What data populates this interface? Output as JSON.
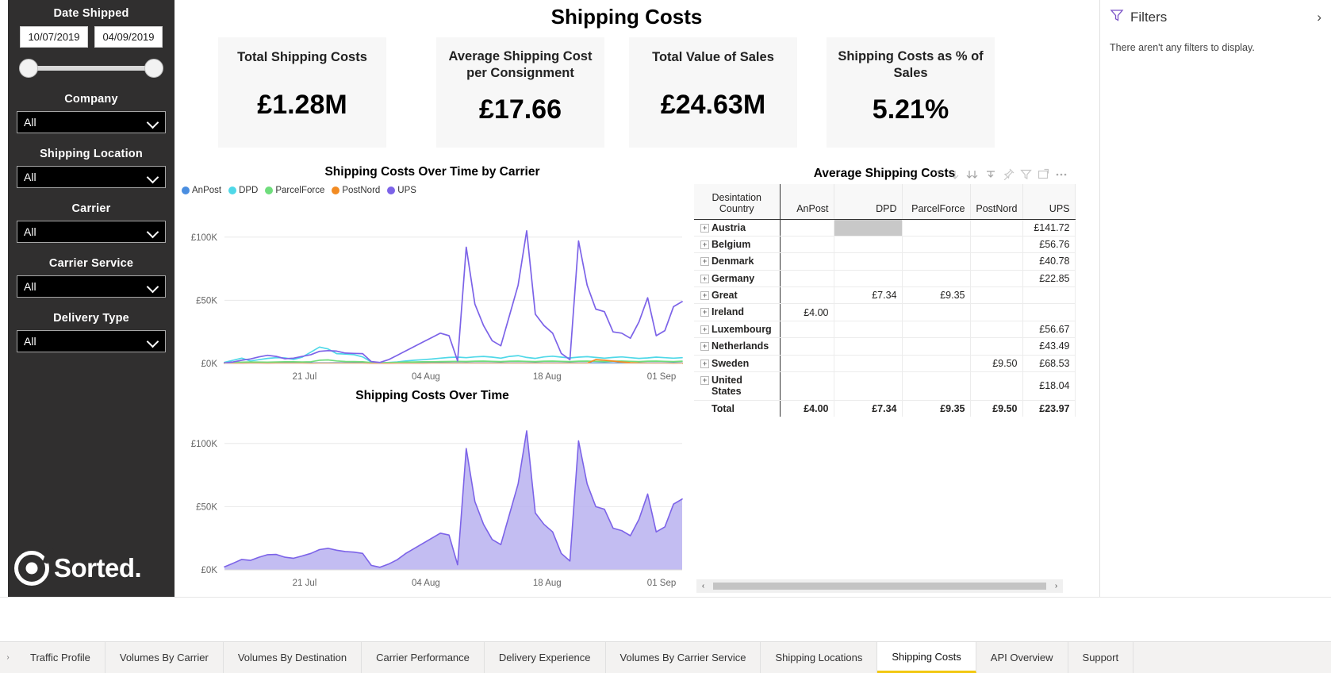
{
  "header": {
    "title": "Shipping Costs"
  },
  "sidebar": {
    "date_slicer": {
      "label": "Date Shipped",
      "start": "10/07/2019",
      "end": "04/09/2019"
    },
    "slicers": [
      {
        "label": "Company",
        "value": "All"
      },
      {
        "label": "Shipping Location",
        "value": "All"
      },
      {
        "label": "Carrier",
        "value": "All"
      },
      {
        "label": "Carrier Service",
        "value": "All"
      },
      {
        "label": "Delivery Type",
        "value": "All"
      }
    ],
    "logo_text": "Sorted."
  },
  "kpis": [
    {
      "label": "Total Shipping Costs",
      "value": "£1.28M"
    },
    {
      "label": "Average Shipping Cost per Consignment",
      "value": "£17.66"
    },
    {
      "label": "Total Value of Sales",
      "value": "£24.63M"
    },
    {
      "label": "Shipping Costs as % of Sales",
      "value": "5.21%"
    }
  ],
  "matrix": {
    "title": "Average Shipping Costs",
    "columns": [
      "Desintation Country",
      "AnPost",
      "DPD",
      "ParcelForce",
      "PostNord",
      "UPS"
    ],
    "rows": [
      {
        "country": "Austria",
        "AnPost": "",
        "DPD": "",
        "ParcelForce": "",
        "PostNord": "",
        "UPS": "£141.72"
      },
      {
        "country": "Belgium",
        "AnPost": "",
        "DPD": "",
        "ParcelForce": "",
        "PostNord": "",
        "UPS": "£56.76"
      },
      {
        "country": "Denmark",
        "AnPost": "",
        "DPD": "",
        "ParcelForce": "",
        "PostNord": "",
        "UPS": "£40.78"
      },
      {
        "country": "Germany",
        "AnPost": "",
        "DPD": "",
        "ParcelForce": "",
        "PostNord": "",
        "UPS": "£22.85"
      },
      {
        "country": "Great",
        "AnPost": "",
        "DPD": "£7.34",
        "ParcelForce": "£9.35",
        "PostNord": "",
        "UPS": ""
      },
      {
        "country": "Ireland",
        "AnPost": "£4.00",
        "DPD": "",
        "ParcelForce": "",
        "PostNord": "",
        "UPS": ""
      },
      {
        "country": "Luxembourg",
        "AnPost": "",
        "DPD": "",
        "ParcelForce": "",
        "PostNord": "",
        "UPS": "£56.67"
      },
      {
        "country": "Netherlands",
        "AnPost": "",
        "DPD": "",
        "ParcelForce": "",
        "PostNord": "",
        "UPS": "£43.49"
      },
      {
        "country": "Sweden",
        "AnPost": "",
        "DPD": "",
        "ParcelForce": "",
        "PostNord": "£9.50",
        "UPS": "£68.53"
      },
      {
        "country": "United States",
        "AnPost": "",
        "DPD": "",
        "ParcelForce": "",
        "PostNord": "",
        "UPS": "£18.04"
      }
    ],
    "total": {
      "country": "Total",
      "AnPost": "£4.00",
      "DPD": "£7.34",
      "ParcelForce": "£9.35",
      "PostNord": "£9.50",
      "UPS": "£23.97"
    },
    "highlight_cell": {
      "row": 0,
      "column": "DPD"
    },
    "toolbar_icons": [
      "drill-up-icon",
      "drill-down-icon",
      "expand-all-icon",
      "drill-through-icon",
      "pin-icon",
      "filter-icon",
      "focus-mode-icon",
      "more-options-icon"
    ],
    "scroll_left_label": "‹",
    "scroll_right_label": "›"
  },
  "filters": {
    "title": "Filters",
    "empty_message": "There aren't any filters to display.",
    "collapse_label": "›"
  },
  "tabs": {
    "scroll_left_label": "›",
    "items": [
      {
        "label": "Traffic Profile",
        "active": false
      },
      {
        "label": "Volumes By Carrier",
        "active": false
      },
      {
        "label": "Volumes By Destination",
        "active": false
      },
      {
        "label": "Carrier Performance",
        "active": false
      },
      {
        "label": "Delivery Experience",
        "active": false
      },
      {
        "label": "Volumes By Carrier Service",
        "active": false
      },
      {
        "label": "Shipping Locations",
        "active": false
      },
      {
        "label": "Shipping Costs",
        "active": true
      },
      {
        "label": "API Overview",
        "active": false
      },
      {
        "label": "Support",
        "active": false
      }
    ],
    "active_accent": "#f2c811"
  },
  "chart_data": [
    {
      "type": "line",
      "title": "Shipping Costs Over Time by Carrier",
      "xlabel": "",
      "ylabel": "",
      "ylim": [
        0,
        125000
      ],
      "yticks": [
        0,
        50000,
        100000
      ],
      "ytick_labels": [
        "£0K",
        "£50K",
        "£100K"
      ],
      "xtick_labels": [
        "21 Jul",
        "04 Aug",
        "18 Aug",
        "01 Sep"
      ],
      "xtick_positions": [
        0.175,
        0.44,
        0.705,
        0.955
      ],
      "grid": true,
      "legend_position": "top-left",
      "series": [
        {
          "name": "AnPost",
          "color": "#4a8ee0",
          "values": [
            300,
            400,
            350,
            500,
            420,
            380,
            450,
            500,
            430,
            400,
            380,
            420,
            460,
            500,
            480,
            440,
            420,
            400,
            380,
            360,
            400,
            420,
            400,
            380,
            360,
            400,
            380,
            360,
            400,
            420,
            400,
            380,
            400,
            420,
            400,
            380,
            360,
            400,
            420,
            400,
            380,
            400,
            420,
            400,
            380,
            360,
            400,
            420,
            400,
            380,
            360,
            400,
            420,
            400
          ]
        },
        {
          "name": "DPD",
          "color": "#4fd8e8",
          "values": [
            900,
            2600,
            4200,
            2000,
            3000,
            4000,
            4600,
            4400,
            3200,
            5000,
            9000,
            13000,
            11500,
            7800,
            7500,
            7000,
            5200,
            1200,
            600,
            800,
            1200,
            2000,
            2600,
            3000,
            3500,
            4200,
            4800,
            5000,
            4600,
            5200,
            5600,
            5000,
            4200,
            5600,
            6200,
            4800,
            4000,
            5200,
            5800,
            5000,
            4400,
            5000,
            5400,
            4800,
            4200,
            4800,
            5200,
            4600,
            4000,
            4400,
            5000,
            4600,
            4200,
            4600
          ]
        },
        {
          "name": "ParcelForce",
          "color": "#6fdd7c",
          "values": [
            600,
            900,
            1000,
            1200,
            1100,
            1000,
            1200,
            1400,
            1300,
            1200,
            1400,
            2600,
            2800,
            2000,
            1600,
            1500,
            1400,
            700,
            500,
            600,
            900,
            1100,
            1200,
            1300,
            1400,
            1500,
            1600,
            1700,
            1600,
            1800,
            1900,
            1700,
            1500,
            1800,
            1900,
            1700,
            1500,
            1800,
            1900,
            1700,
            1500,
            1800,
            1900,
            1700,
            1500,
            1800,
            1900,
            1700,
            1500,
            1800,
            1900,
            1700,
            1500,
            1800
          ]
        },
        {
          "name": "PostNord",
          "color": "#f28b22",
          "values": [
            100,
            150,
            120,
            180,
            160,
            140,
            170,
            200,
            180,
            160,
            150,
            190,
            210,
            200,
            180,
            170,
            160,
            80,
            60,
            70,
            100,
            120,
            140,
            150,
            160,
            170,
            180,
            190,
            180,
            200,
            210,
            190,
            170,
            200,
            210,
            190,
            170,
            200,
            210,
            190,
            170,
            200,
            210,
            3100,
            2600,
            1900,
            1200,
            600,
            300,
            200,
            180,
            160,
            150,
            160
          ]
        },
        {
          "name": "UPS",
          "color": "#7c63e8",
          "values": [
            500,
            1200,
            2600,
            3600,
            5200,
            6500,
            5600,
            3800,
            4200,
            5600,
            7000,
            9600,
            10200,
            9800,
            8200,
            8000,
            7800,
            1500,
            800,
            3000,
            6500,
            10000,
            13500,
            17000,
            20500,
            24000,
            22000,
            2000,
            92000,
            47000,
            30000,
            18000,
            14000,
            38000,
            62000,
            105000,
            39000,
            30000,
            24000,
            8000,
            3000,
            97000,
            62000,
            43000,
            41000,
            25000,
            24000,
            20000,
            33000,
            52000,
            22000,
            26000,
            45000,
            49000
          ]
        }
      ]
    },
    {
      "type": "area",
      "title": "Shipping Costs Over Time",
      "xlabel": "",
      "ylabel": "",
      "ylim": [
        0,
        125000
      ],
      "yticks": [
        0,
        50000,
        100000
      ],
      "ytick_labels": [
        "£0K",
        "£50K",
        "£100K"
      ],
      "xtick_labels": [
        "21 Jul",
        "04 Aug",
        "18 Aug",
        "01 Sep"
      ],
      "xtick_positions": [
        0.175,
        0.44,
        0.705,
        0.955
      ],
      "grid": true,
      "fill_color": "#b9b2f0",
      "line_color": "#7c63e8",
      "series": [
        {
          "name": "Shipping Costs",
          "color": "#7c63e8",
          "values": [
            2400,
            5200,
            8200,
            7500,
            10000,
            12000,
            12200,
            10000,
            9200,
            11000,
            13000,
            16000,
            17000,
            15500,
            14500,
            14000,
            13000,
            3500,
            2000,
            4500,
            8000,
            13000,
            17000,
            21000,
            25000,
            29000,
            27500,
            4000,
            96000,
            54000,
            36000,
            24000,
            20000,
            44000,
            68000,
            110000,
            45000,
            36000,
            30000,
            13000,
            7000,
            102000,
            68000,
            50000,
            48000,
            33000,
            31000,
            27000,
            40000,
            60000,
            30000,
            34000,
            52000,
            56000
          ]
        }
      ]
    }
  ]
}
